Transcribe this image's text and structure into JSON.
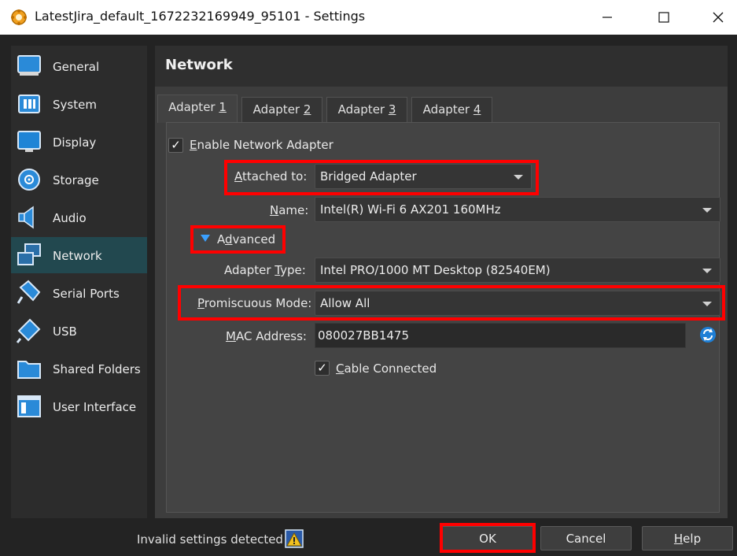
{
  "window": {
    "title": "LatestJira_default_1672232169949_95101 - Settings",
    "controls": [
      "minimize",
      "maximize",
      "close"
    ]
  },
  "sidebar": {
    "items": [
      {
        "label": "General",
        "icon": "general-icon"
      },
      {
        "label": "System",
        "icon": "system-chip-icon"
      },
      {
        "label": "Display",
        "icon": "monitor-icon"
      },
      {
        "label": "Storage",
        "icon": "disk-icon"
      },
      {
        "label": "Audio",
        "icon": "speaker-icon"
      },
      {
        "label": "Network",
        "icon": "network-icon",
        "selected": true
      },
      {
        "label": "Serial Ports",
        "icon": "serial-port-icon"
      },
      {
        "label": "USB",
        "icon": "usb-icon"
      },
      {
        "label": "Shared Folders",
        "icon": "folder-icon"
      },
      {
        "label": "User Interface",
        "icon": "window-ui-icon"
      }
    ]
  },
  "header": {
    "title": "Network"
  },
  "tabs": [
    {
      "label": "Adapter 1",
      "prefix": "Adapter ",
      "mnemonic": "1",
      "active": true
    },
    {
      "label": "Adapter 2",
      "prefix": "Adapter ",
      "mnemonic": "2"
    },
    {
      "label": "Adapter 3",
      "prefix": "Adapter ",
      "mnemonic": "3"
    },
    {
      "label": "Adapter 4",
      "prefix": "Adapter ",
      "mnemonic": "4"
    }
  ],
  "adapter": {
    "enable": {
      "label": "Enable Network Adapter",
      "mnemonic": "E",
      "rest": "nable Network Adapter",
      "checked": true
    },
    "attached_to": {
      "label": "Attached to:",
      "mnemonic": "A",
      "rest": "ttached to:",
      "value": "Bridged Adapter"
    },
    "name": {
      "label": "Name:",
      "mnemonic": "N",
      "rest": "ame:",
      "value": "Intel(R) Wi-Fi 6 AX201 160MHz"
    },
    "advanced": {
      "label": "Advanced",
      "pre": "A",
      "mnemonic": "d",
      "rest": "vanced",
      "expanded": true
    },
    "adapter_type": {
      "label": "Adapter Type:",
      "pre": "Adapter ",
      "mnemonic": "T",
      "rest": "ype:",
      "value": "Intel PRO/1000 MT Desktop (82540EM)"
    },
    "promiscuous": {
      "label": "Promiscuous Mode:",
      "mnemonic": "P",
      "rest": "romiscuous Mode:",
      "value": "Allow All"
    },
    "mac": {
      "label": "MAC Address:",
      "mnemonic": "M",
      "rest": "AC Address:",
      "value": "080027BB1475",
      "refresh_icon": "refresh-icon"
    },
    "cable": {
      "label": "Cable Connected",
      "mnemonic": "C",
      "rest": "able Connected",
      "checked": true
    }
  },
  "footer": {
    "status": "Invalid settings detected",
    "warning_icon": "warning-icon",
    "ok": "OK",
    "cancel": "Cancel",
    "help": "Help",
    "help_mnemonic": "H",
    "help_rest": "elp"
  },
  "highlight_color": "#ff0000",
  "selected_color": "#22484f"
}
